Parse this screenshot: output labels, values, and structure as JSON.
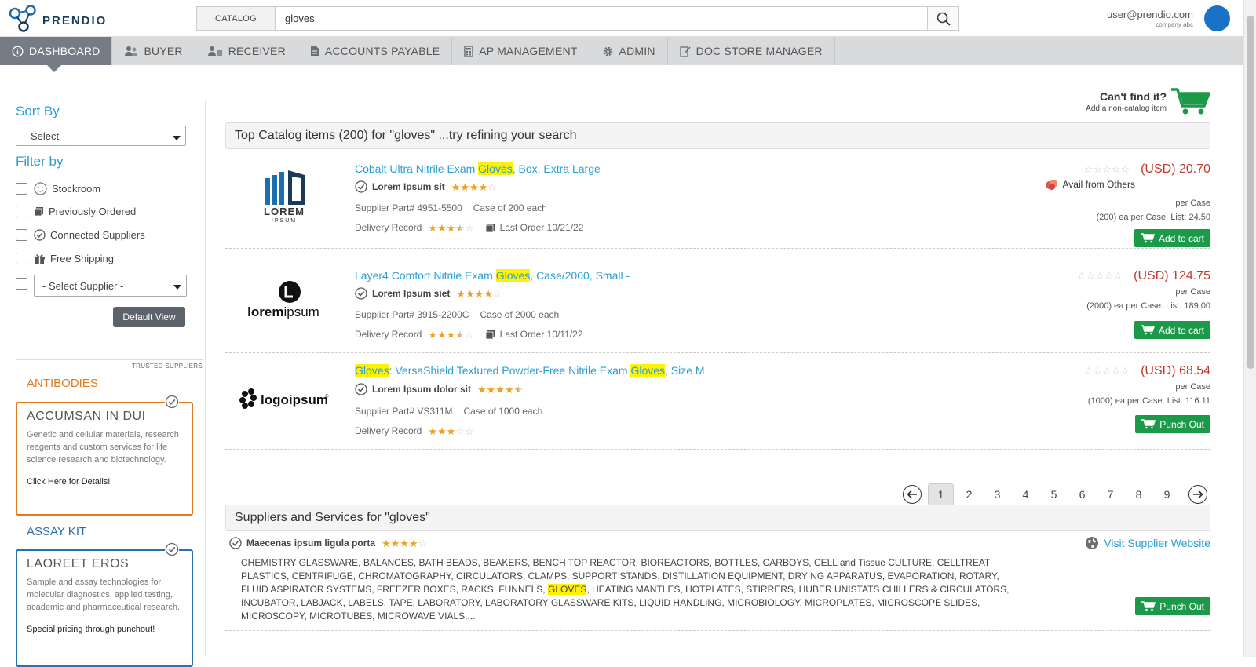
{
  "header": {
    "logo_text": "PRENDIO",
    "search_scope": "CATALOG",
    "search_value": "gloves",
    "user_email": "user@prendio.com",
    "user_company": "company abc"
  },
  "nav": [
    {
      "label": "DASHBOARD",
      "icon": "info-icon",
      "active": true
    },
    {
      "label": "BUYER",
      "icon": "users-icon"
    },
    {
      "label": "RECEIVER",
      "icon": "receiver-icon"
    },
    {
      "label": "ACCOUNTS PAYABLE",
      "icon": "document-icon"
    },
    {
      "label": "AP MANAGEMENT",
      "icon": "calculator-icon"
    },
    {
      "label": "ADMIN",
      "icon": "gear-icon"
    },
    {
      "label": "DOC STORE MANAGER",
      "icon": "edit-document-icon"
    }
  ],
  "sidebar": {
    "sort_heading": "Sort By",
    "sort_value": "- Select -",
    "filter_heading": "Filter by",
    "filters": [
      {
        "label": "Stockroom",
        "icon": "smiley-icon"
      },
      {
        "label": "Previously Ordered",
        "icon": "copy-icon"
      },
      {
        "label": "Connected Suppliers",
        "icon": "check-circle-icon"
      },
      {
        "label": "Free Shipping",
        "icon": "gift-icon"
      }
    ],
    "supplier_select": "- Select Supplier -",
    "default_view": "Default View",
    "trusted_label": "TRUSTED SUPPLIERS",
    "ads": [
      {
        "label": "ANTIBODIES",
        "title": "ACCUMSAN IN DUI",
        "desc": "Genetic and cellular materials, research reagents and custom services for life science research and biotechnology.",
        "link": "Click Here for Details!",
        "color": "#e07a1f"
      },
      {
        "label": "ASSAY KIT",
        "title": "LAOREET EROS",
        "desc": "Sample and assay technologies for molecular diagnostics, applied testing, academic and pharmaceutical research.",
        "link": "Special pricing through punchout!",
        "color": "#2a6fb5"
      }
    ]
  },
  "cant_find": {
    "title": "Can't find it?",
    "subtitle": "Add a non-catalog item"
  },
  "catalog_header": "Top Catalog items (200) for \"gloves\" ...try refining your search",
  "products": [
    {
      "title_parts": [
        "Cobalt Ultra Nitrile Exam ",
        "Gloves",
        ", Box, Extra Large"
      ],
      "supplier": "Lorem Ipsum sit",
      "supplier_rating": 4,
      "part": "Supplier Part# 4951-5500",
      "pack": "Case of 200 each",
      "delivery_label": "Delivery Record",
      "delivery_rating": 3.5,
      "last_order": "Last Order 10/21/22",
      "price": "(USD) 20.70",
      "avail": "Avail from Others",
      "per": "per Case",
      "ea": "(200) ea per Case. List: 24.50",
      "button": "Add to cart",
      "logo": "lorem-logo"
    },
    {
      "title_parts": [
        "Layer4 Comfort Nitrile Exam ",
        "Gloves",
        ", Case/2000, Small -"
      ],
      "supplier": "Lorem Ipsum siet",
      "supplier_rating": 4,
      "part": "Supplier Part# 3915-2200C",
      "pack": "Case of 2000 each",
      "delivery_label": "Delivery Record",
      "delivery_rating": 3.5,
      "last_order": "Last Order 10/11/22",
      "price": "(USD) 124.75",
      "per": "per Case",
      "ea": "(2000) ea per Case. List: 189.00",
      "button": "Add to cart",
      "logo": "loremipsum-logo"
    },
    {
      "title_parts": [
        "Gloves",
        ": VersaShield Textured Powder-Free Nitrile Exam ",
        "Gloves",
        ", Size M"
      ],
      "supplier": "Lorem Ipsum dolor sit",
      "supplier_rating": 4.5,
      "part": "Supplier Part# VS311M",
      "pack": "Case of 1000 each",
      "delivery_label": "Delivery Record",
      "delivery_rating": 3,
      "price": "(USD) 68.54",
      "per": "per Case",
      "ea": "(1000) ea per Case. List: 116.11",
      "button": "Punch Out",
      "logo": "logoipsum-logo"
    }
  ],
  "pagination": {
    "pages": [
      "1",
      "2",
      "3",
      "4",
      "5",
      "6",
      "7",
      "8",
      "9"
    ],
    "current": "1"
  },
  "services_header": "Suppliers and Services for \"gloves\"",
  "services": {
    "supplier": "Maecenas ipsum ligula porta",
    "rating": 4,
    "visit": "Visit Supplier Website",
    "text_before": "CHEMISTRY GLASSWARE, BALANCES, BATH BEADS, BEAKERS, BENCH TOP REACTOR, BIOREACTORS, BOTTLES, CARBOYS, CELL and Tissue CULTURE, CELLTREAT PLASTICS, CENTRIFUGE, CHROMATOGRAPHY, CIRCULATORS, CLAMPS, SUPPORT STANDS, DISTILLATION EQUIPMENT, DRYING APPARATUS, EVAPORATION, ROTARY, FLUID ASPIRATOR SYSTEMS, FREEZER BOXES, RACKS, FUNNELS, ",
    "text_highlight": "GLOVES",
    "text_after": ", HEATING MANTLES, HOTPLATES, STIRRERS, HUBER UNISTATS CHILLERS & CIRCULATORS, INCUBATOR, LABJACK, LABELS, TAPE, LABORATORY, LABORATORY GLASSWARE KITS, LIQUID HANDLING, MICROBIOLOGY, MICROPLATES, MICROSCOPE SLIDES, MICROSCOPY, MICROTUBES, MICROWAVE VIALS,...",
    "button": "Punch Out"
  }
}
